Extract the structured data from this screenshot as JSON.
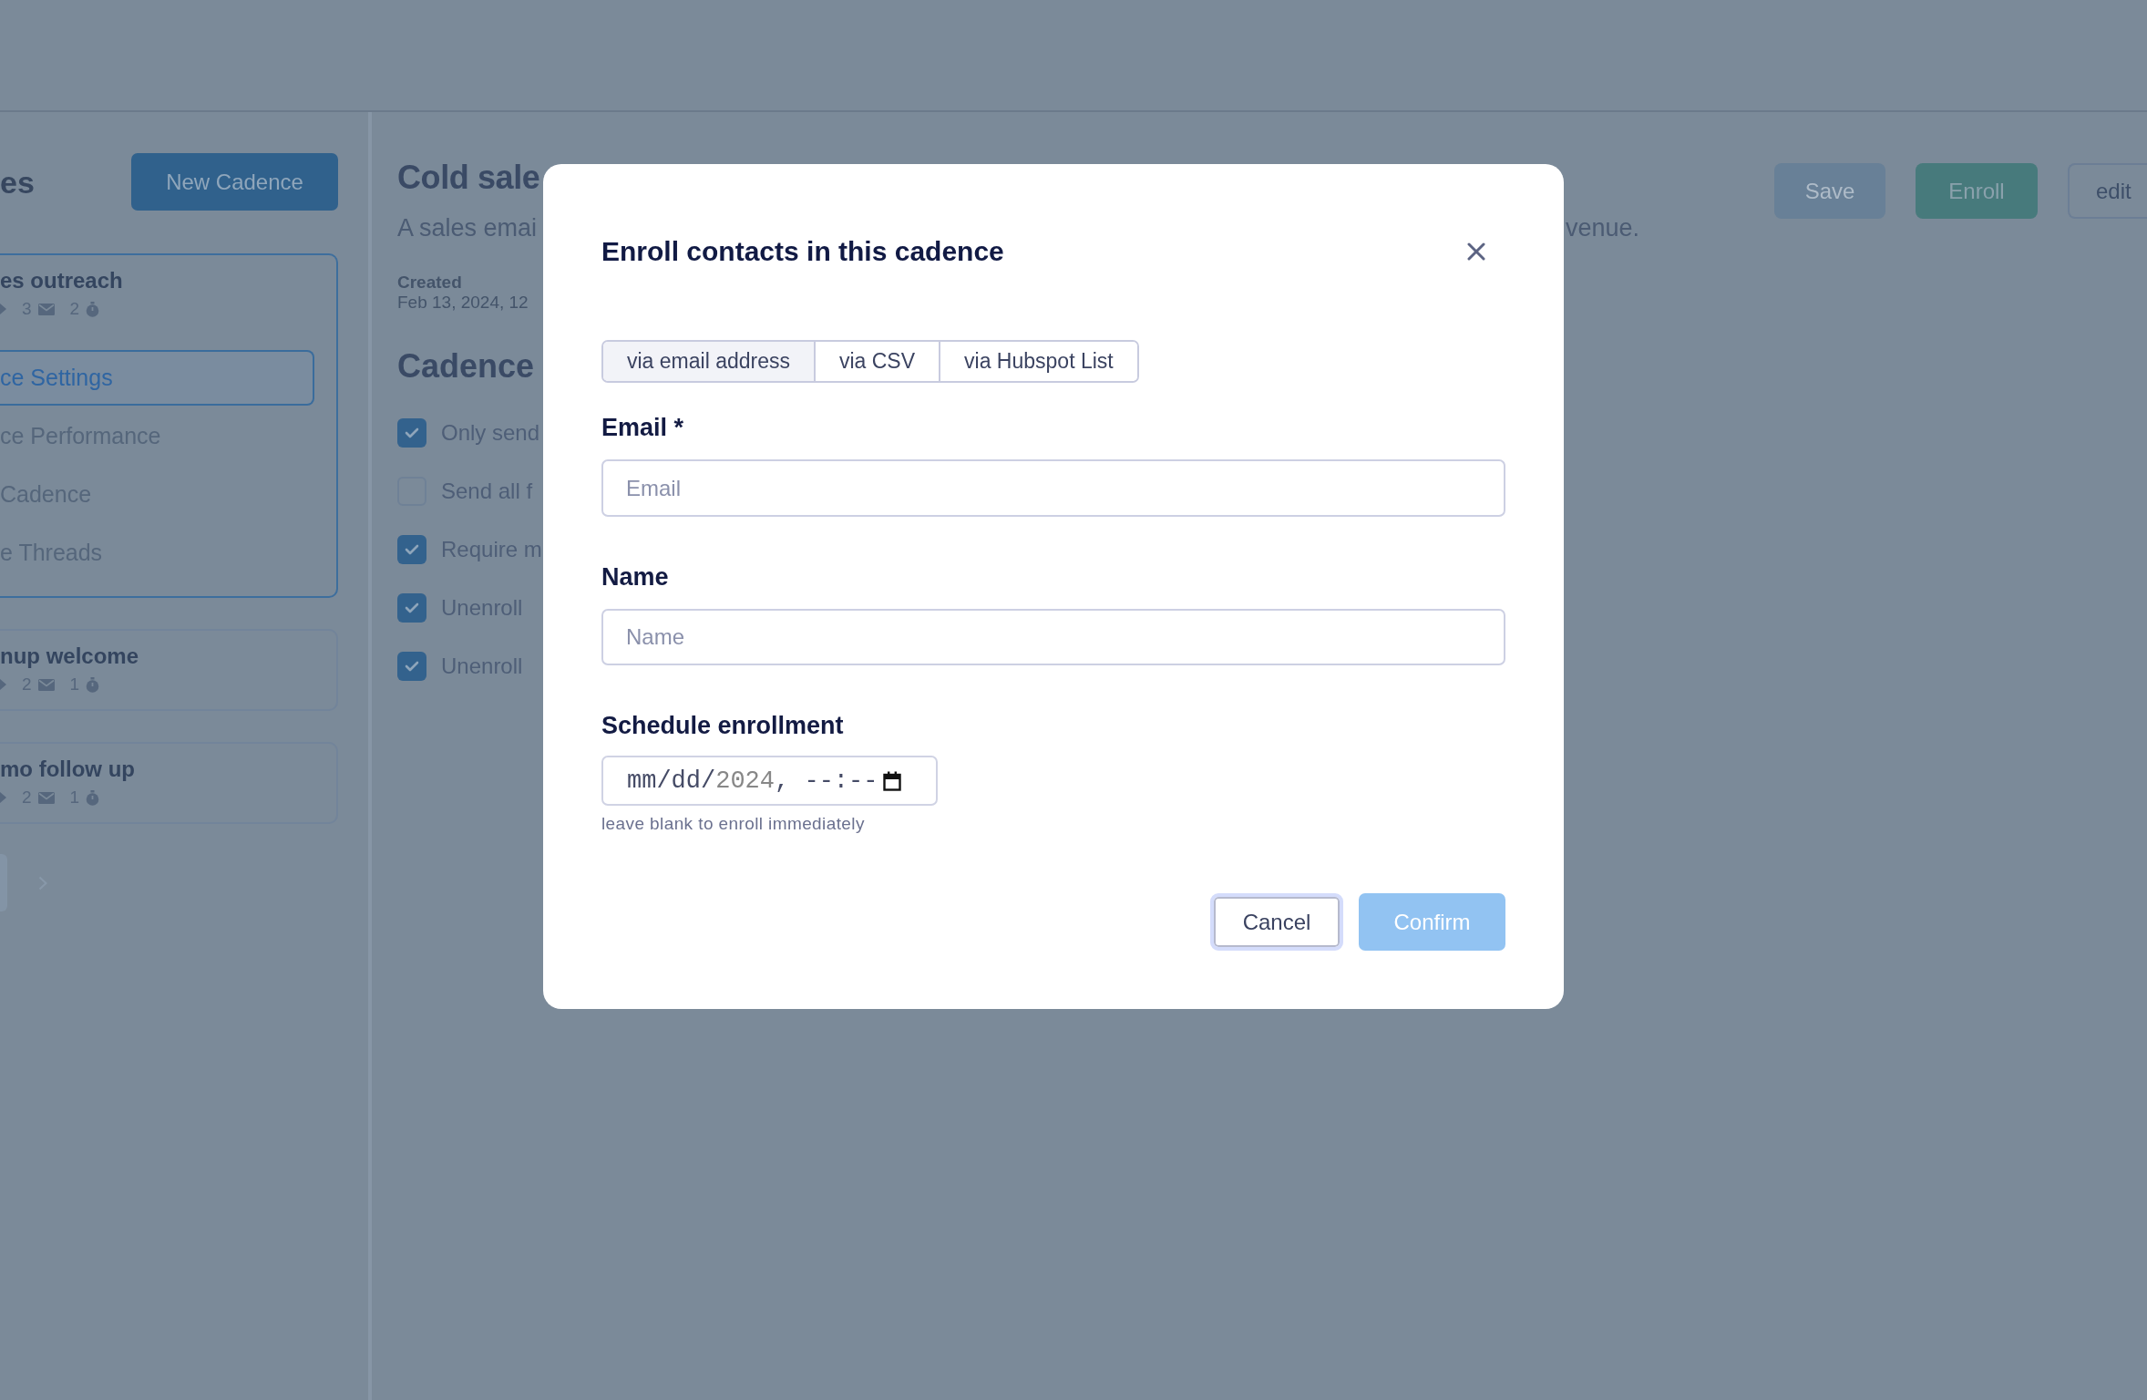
{
  "sidebar": {
    "title": "es",
    "new_button": "New Cadence",
    "cadences": [
      {
        "name": "es outreach",
        "selected": true,
        "stats": [
          {
            "kind": "steps"
          },
          {
            "kind": "emails",
            "count": "3"
          },
          {
            "kind": "timers",
            "count": "2"
          }
        ],
        "menu": [
          {
            "label": "ce Settings",
            "selected": true
          },
          {
            "label": "ce Performance",
            "selected": false
          },
          {
            "label": "Cadence",
            "selected": false
          },
          {
            "label": "e Threads",
            "selected": false
          }
        ]
      },
      {
        "name": "nup welcome",
        "selected": false,
        "stats": [
          {
            "kind": "steps"
          },
          {
            "kind": "emails",
            "count": "2"
          },
          {
            "kind": "timers",
            "count": "1"
          }
        ]
      },
      {
        "name": "mo follow up",
        "selected": false,
        "stats": [
          {
            "kind": "steps"
          },
          {
            "kind": "emails",
            "count": "2"
          },
          {
            "kind": "timers",
            "count": "1"
          }
        ]
      }
    ],
    "pagination": {
      "next_disabled": true
    }
  },
  "cadence": {
    "title": "Cold sale",
    "description": [
      "A sales emai",
      "venue."
    ],
    "created_label": "Created",
    "created_value": "Feb 13, 2024, 12",
    "settings_heading": "Cadence",
    "settings": [
      {
        "label": "Only send",
        "checked": true
      },
      {
        "label": "Send all f",
        "checked": false
      },
      {
        "label": "Require m",
        "checked": true
      },
      {
        "label": "Unenroll",
        "checked": true
      },
      {
        "label": "Unenroll",
        "checked": true
      }
    ],
    "actions": [
      {
        "label": "Save",
        "kind": "primary",
        "disabled": true
      },
      {
        "label": "Enroll",
        "kind": "success",
        "disabled": false
      },
      {
        "label": "edit",
        "kind": "outline",
        "disabled": false
      }
    ]
  },
  "modal": {
    "title": "Enroll contacts in this cadence",
    "tabs": [
      {
        "label": "via email address",
        "selected": true
      },
      {
        "label": "via CSV",
        "selected": false
      },
      {
        "label": "via Hubspot List",
        "selected": false
      }
    ],
    "fields": [
      {
        "kind": "email",
        "label": "Email *",
        "placeholder": "Email"
      },
      {
        "kind": "text",
        "label": "Name",
        "placeholder": "Name"
      },
      {
        "kind": "datetime",
        "label": "Schedule enrollment",
        "segments": [
          {
            "text": "mm/dd/",
            "dim": false
          },
          {
            "text": "2024",
            "dim": true
          },
          {
            "text": ", --:--",
            "dim": false
          }
        ],
        "hint": "leave blank to enroll immediately"
      }
    ],
    "buttons": [
      {
        "label": "Cancel",
        "kind": "secondary",
        "focused": true,
        "disabled": false
      },
      {
        "label": "Confirm",
        "kind": "primary",
        "focused": false,
        "disabled": true
      }
    ]
  }
}
